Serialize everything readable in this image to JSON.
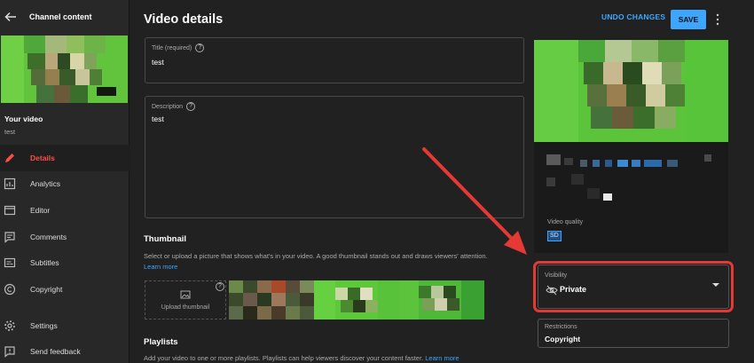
{
  "sidebar": {
    "title": "Channel content",
    "video_label": "Your video",
    "video_name": "test",
    "items": [
      {
        "label": "Details",
        "icon": "pencil-icon",
        "active": true
      },
      {
        "label": "Analytics",
        "icon": "analytics-icon",
        "active": false
      },
      {
        "label": "Editor",
        "icon": "editor-icon",
        "active": false
      },
      {
        "label": "Comments",
        "icon": "comments-icon",
        "active": false
      },
      {
        "label": "Subtitles",
        "icon": "subtitles-icon",
        "active": false
      },
      {
        "label": "Copyright",
        "icon": "copyright-icon",
        "active": false
      }
    ],
    "bottom_items": [
      {
        "label": "Settings",
        "icon": "gear-icon"
      },
      {
        "label": "Send feedback",
        "icon": "feedback-icon"
      }
    ]
  },
  "header": {
    "title": "Video details",
    "undo_label": "UNDO CHANGES",
    "save_label": "SAVE"
  },
  "form": {
    "title_label": "Title (required)",
    "title_value": "test",
    "description_label": "Description",
    "description_value": "test"
  },
  "thumbnail": {
    "heading": "Thumbnail",
    "text": "Select or upload a picture that shows what's in your video. A good thumbnail stands out and draws viewers' attention.",
    "learn_more": "Learn more",
    "upload_label": "Upload thumbnail"
  },
  "playlists": {
    "heading": "Playlists",
    "text": "Add your video to one or more playlists. Playlists can help viewers discover your content faster.",
    "learn_more": "Learn more"
  },
  "preview": {
    "video_quality_label": "Video quality",
    "video_quality_badge": "SD"
  },
  "visibility": {
    "label": "Visibility",
    "value": "Private"
  },
  "restrictions": {
    "label": "Restrictions",
    "value": "Copyright"
  },
  "colors": {
    "accent": "#3ea6ff",
    "active_nav": "#ff4e45",
    "annotation": "#e53935",
    "background": "#212121"
  }
}
